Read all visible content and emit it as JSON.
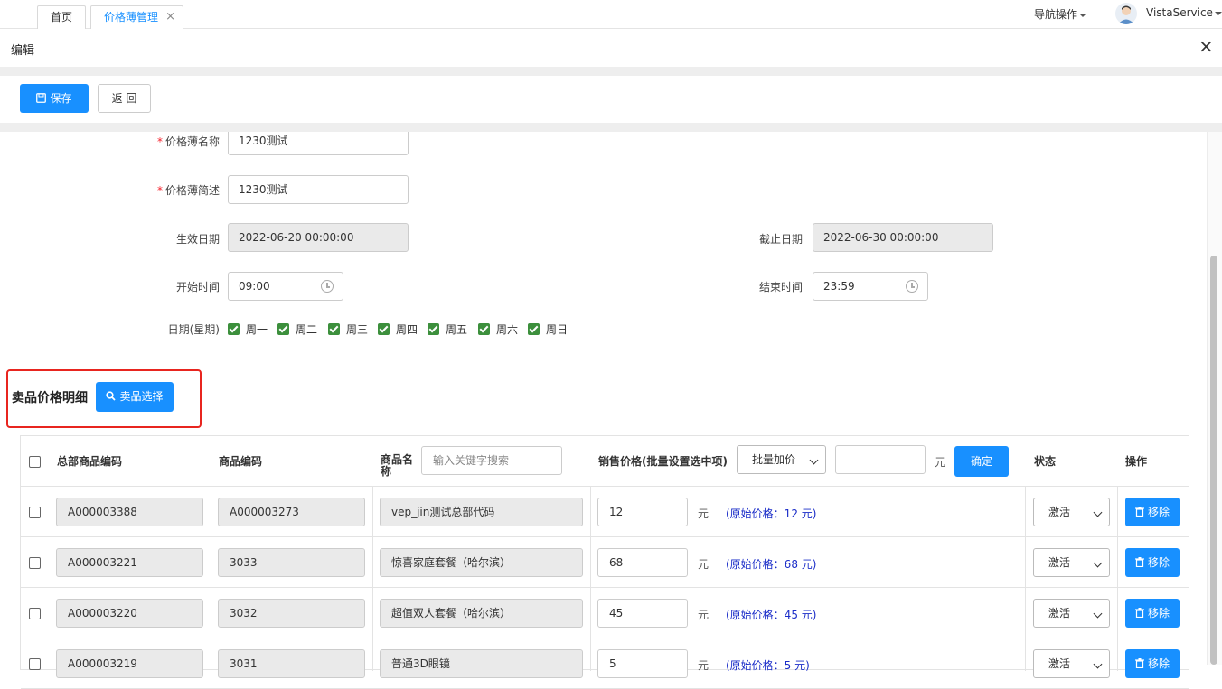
{
  "tabs": {
    "home": "首页",
    "active": "价格薄管理",
    "close": "×"
  },
  "header": {
    "nav_ops": "导航操作",
    "user": "VistaService"
  },
  "dialog": {
    "title": "编辑",
    "close": "×"
  },
  "toolbar": {
    "save": "保存",
    "back": "返 回"
  },
  "form": {
    "name_label": "价格薄名称",
    "name_value": "1230测试",
    "desc_label": "价格薄简述",
    "desc_value": "1230测试",
    "start_date_label": "生效日期",
    "start_date_value": "2022-06-20 00:00:00",
    "end_date_label": "截止日期",
    "end_date_value": "2022-06-30 00:00:00",
    "start_time_label": "开始时间",
    "start_time_value": "09:00",
    "end_time_label": "结束时间",
    "end_time_value": "23:59",
    "weekday_label": "日期(星期)",
    "weekdays": [
      "周一",
      "周二",
      "周三",
      "周四",
      "周五",
      "周六",
      "周日"
    ]
  },
  "section": {
    "title": "卖品价格明细",
    "pick_button": "卖品选择"
  },
  "table": {
    "headers": {
      "hq_code": "总部商品编码",
      "code": "商品编码",
      "name_line1": "商品名",
      "name_line2": "称",
      "search_placeholder": "输入关键字搜索",
      "price": "销售价格(批量设置选中项)",
      "batch_option": "批量加价",
      "unit": "元",
      "confirm": "确定",
      "status": "状态",
      "ops": "操作"
    },
    "rows": [
      {
        "hq_code": "A000003388",
        "code": "A000003273",
        "name": "vep_jin测试总部代码",
        "price": "12",
        "unit": "元",
        "orig": "(原始价格：12 元)",
        "status": "激活",
        "remove": "移除"
      },
      {
        "hq_code": "A000003221",
        "code": "3033",
        "name": "惊喜家庭套餐（哈尔滨）",
        "price": "68",
        "unit": "元",
        "orig": "(原始价格：68 元)",
        "status": "激活",
        "remove": "移除"
      },
      {
        "hq_code": "A000003220",
        "code": "3032",
        "name": "超值双人套餐（哈尔滨）",
        "price": "45",
        "unit": "元",
        "orig": "(原始价格：45 元)",
        "status": "激活",
        "remove": "移除"
      },
      {
        "hq_code": "A000003219",
        "code": "3031",
        "name": "普通3D眼镜",
        "price": "5",
        "unit": "元",
        "orig": "(原始价格：5 元)",
        "status": "激活",
        "remove": "移除"
      }
    ]
  }
}
